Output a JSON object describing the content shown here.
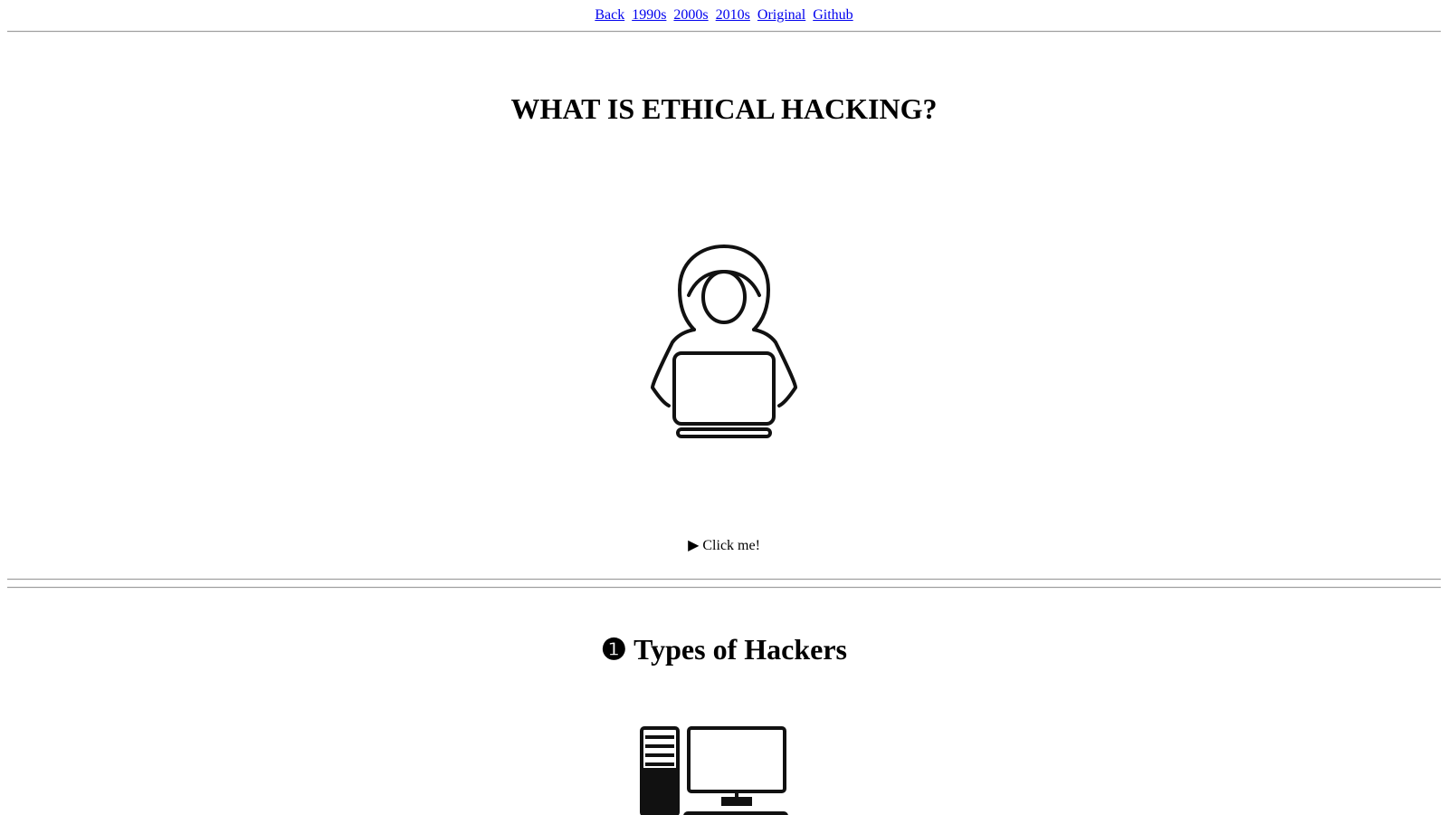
{
  "nav": {
    "links": [
      {
        "label": "Back"
      },
      {
        "label": "1990s"
      },
      {
        "label": "2000s"
      },
      {
        "label": "2010s"
      },
      {
        "label": "Original"
      },
      {
        "label": "Github"
      }
    ]
  },
  "main": {
    "title": "WHAT IS ETHICAL HACKING?",
    "details_summary": "▶ Click me!"
  },
  "section1": {
    "title": "❶ Types of Hackers"
  },
  "colors": {
    "link": "#0000ee",
    "text": "#000000",
    "background": "#ffffff"
  }
}
